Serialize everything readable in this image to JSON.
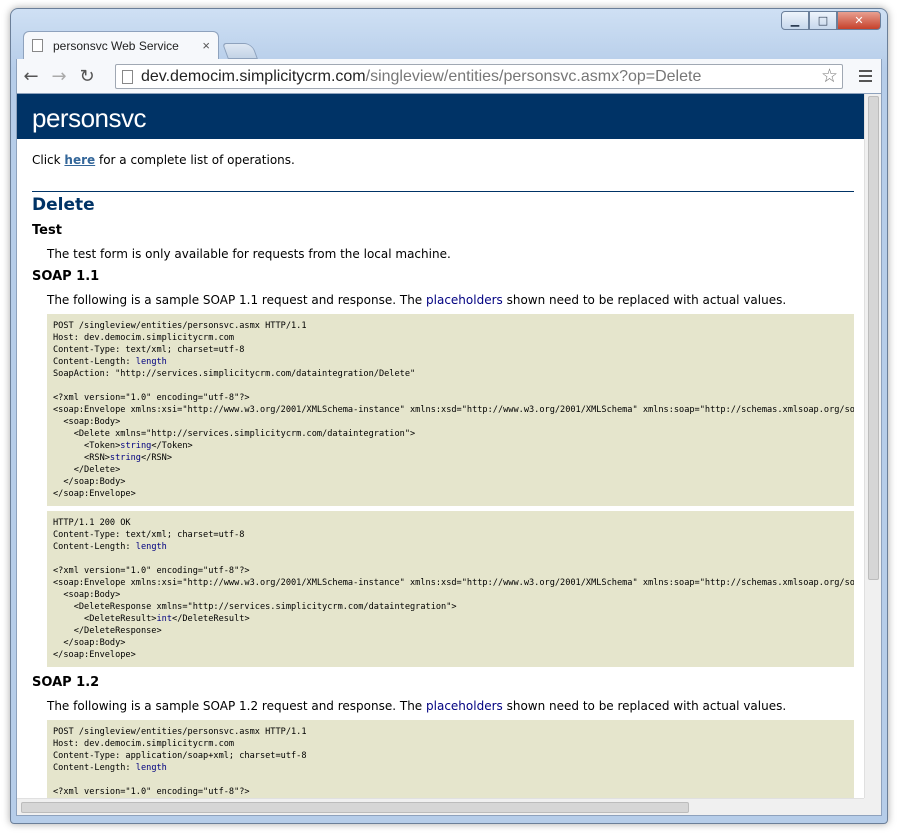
{
  "window": {
    "min_glyph": "▁",
    "max_glyph": "□",
    "close_glyph": "✕"
  },
  "tab": {
    "title": "personsvc Web Service",
    "close_glyph": "×"
  },
  "toolbar": {
    "back_glyph": "←",
    "forward_glyph": "→",
    "reload_glyph": "↻",
    "url_host": "dev.democim.simplicitycrm.com",
    "url_path": "/singleview/entities/personsvc.asmx?op=Delete",
    "star_glyph": "☆"
  },
  "page": {
    "heading": "personsvc",
    "intro_before": "Click ",
    "intro_link": "here",
    "intro_after": " for a complete list of operations.",
    "operation": "Delete",
    "test_heading": "Test",
    "test_text": "The test form is only available for requests from the local machine.",
    "soap11_heading": "SOAP 1.1",
    "soap11_text_before": "The following is a sample SOAP 1.1 request and response. The ",
    "soap11_placeholders": "placeholders",
    "soap11_text_after": " shown need to be replaced with actual values.",
    "soap12_heading": "SOAP 1.2",
    "soap12_text_before": "The following is a sample SOAP 1.2 request and response. The ",
    "soap12_placeholders": "placeholders",
    "soap12_text_after": " shown need to be replaced with actual values."
  },
  "soap11_request": {
    "l1": "POST /singleview/entities/personsvc.asmx HTTP/1.1",
    "l2": "Host: dev.democim.simplicitycrm.com",
    "l3": "Content-Type: text/xml; charset=utf-8",
    "l4a": "Content-Length: ",
    "l4b": "length",
    "l5": "SoapAction: \"http://services.simplicitycrm.com/dataintegration/Delete\"",
    "l6": "<?xml version=\"1.0\" encoding=\"utf-8\"?>",
    "l7": "<soap:Envelope xmlns:xsi=\"http://www.w3.org/2001/XMLSchema-instance\" xmlns:xsd=\"http://www.w3.org/2001/XMLSchema\" xmlns:soap=\"http://schemas.xmlsoap.org/soap/envelope/\">",
    "l8": "  <soap:Body>",
    "l9": "    <Delete xmlns=\"http://services.simplicitycrm.com/dataintegration\">",
    "l10a": "      <Token>",
    "l10b": "string",
    "l10c": "</Token>",
    "l11a": "      <RSN>",
    "l11b": "string",
    "l11c": "</RSN>",
    "l12": "    </Delete>",
    "l13": "  </soap:Body>",
    "l14": "</soap:Envelope>"
  },
  "soap11_response": {
    "l1": "HTTP/1.1 200 OK",
    "l2": "Content-Type: text/xml; charset=utf-8",
    "l3a": "Content-Length: ",
    "l3b": "length",
    "l4": "<?xml version=\"1.0\" encoding=\"utf-8\"?>",
    "l5": "<soap:Envelope xmlns:xsi=\"http://www.w3.org/2001/XMLSchema-instance\" xmlns:xsd=\"http://www.w3.org/2001/XMLSchema\" xmlns:soap=\"http://schemas.xmlsoap.org/soap/envelope/\">",
    "l6": "  <soap:Body>",
    "l7": "    <DeleteResponse xmlns=\"http://services.simplicitycrm.com/dataintegration\">",
    "l8a": "      <DeleteResult>",
    "l8b": "int",
    "l8c": "</DeleteResult>",
    "l9": "    </DeleteResponse>",
    "l10": "  </soap:Body>",
    "l11": "</soap:Envelope>"
  },
  "soap12_request": {
    "l1": "POST /singleview/entities/personsvc.asmx HTTP/1.1",
    "l2": "Host: dev.democim.simplicitycrm.com",
    "l3": "Content-Type: application/soap+xml; charset=utf-8",
    "l4a": "Content-Length: ",
    "l4b": "length",
    "l5": "<?xml version=\"1.0\" encoding=\"utf-8\"?>"
  }
}
